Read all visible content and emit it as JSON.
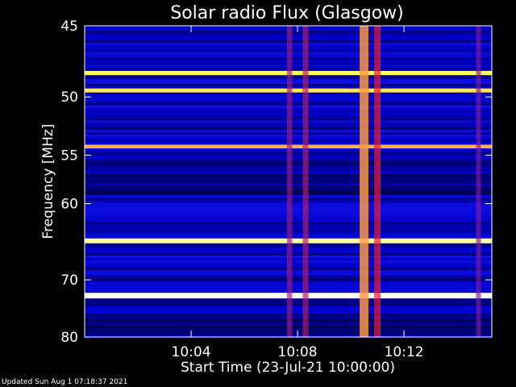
{
  "chart_data": {
    "type": "heatmap",
    "title": "Solar radio Flux (Glasgow)",
    "xlabel": "Start Time (23-Jul-21 10:00:00)",
    "ylabel": "Frequency [MHz]",
    "xlim_minutes": [
      0,
      15.3
    ],
    "ylim": [
      45,
      80
    ],
    "x_ticks": [
      {
        "minute": 4,
        "label": "10:04"
      },
      {
        "minute": 8,
        "label": "10:08"
      },
      {
        "minute": 12,
        "label": "10:12"
      }
    ],
    "y_ticks": [
      {
        "value": 45,
        "label": "45"
      },
      {
        "value": 50,
        "label": "50"
      },
      {
        "value": 55,
        "label": "55"
      },
      {
        "value": 60,
        "label": "60"
      },
      {
        "value": 70,
        "label": "70"
      },
      {
        "value": 80,
        "label": "80"
      }
    ],
    "grid": false,
    "colormap": [
      "#000000",
      "#0000c8",
      "#1e1eff",
      "#ff1e1e",
      "#ffff64",
      "#ffffff"
    ],
    "horizontal_bands": [
      {
        "freq": 48.2,
        "intensity": 0.55
      },
      {
        "freq": 49.5,
        "intensity": 0.5
      },
      {
        "freq": 54.2,
        "intensity": 0.4
      },
      {
        "freq": 64.5,
        "intensity": 0.75
      },
      {
        "freq": 72.5,
        "intensity": 1.0
      }
    ],
    "vertical_bursts": [
      {
        "minute": 7.7,
        "intensity": 0.35
      },
      {
        "minute": 8.3,
        "intensity": 0.4
      },
      {
        "minute": 10.5,
        "intensity": 0.8
      },
      {
        "minute": 11.0,
        "intensity": 0.5
      },
      {
        "minute": 14.8,
        "intensity": 0.3
      }
    ]
  },
  "footer": {
    "updated": "Updated Sun Aug  1 07:18:37 2021"
  },
  "colors": {
    "background": "#000000",
    "text": "#ffffff"
  }
}
